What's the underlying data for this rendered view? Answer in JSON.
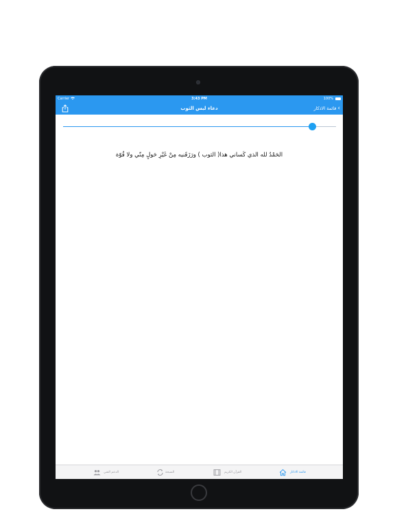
{
  "status": {
    "carrier": "Carrier",
    "time": "3:43 PM",
    "battery": "100%"
  },
  "nav": {
    "title": "دعاء لبس الثوب",
    "back_label": "قائمة الاذكار"
  },
  "player": {
    "progress": 0.97
  },
  "dua": {
    "text": "الحَمْدُ لله الذي كَساني هذا( الثوب ) ورَزَقَنيه مِنْ غَيْرِ حَولٍ مِنّي ولا قُوّة"
  },
  "tabs": [
    {
      "label": "الدعم الفني",
      "icon": "people-icon",
      "active": false
    },
    {
      "label": "السبحة",
      "icon": "refresh-icon",
      "active": false
    },
    {
      "label": "القرآن الكريم",
      "icon": "film-icon",
      "active": false
    },
    {
      "label": "قائمة الاذكار",
      "icon": "home-icon",
      "active": true
    }
  ],
  "colors": {
    "accent": "#2b98f0",
    "inactive": "#9a9a9f",
    "device": "#111214"
  }
}
